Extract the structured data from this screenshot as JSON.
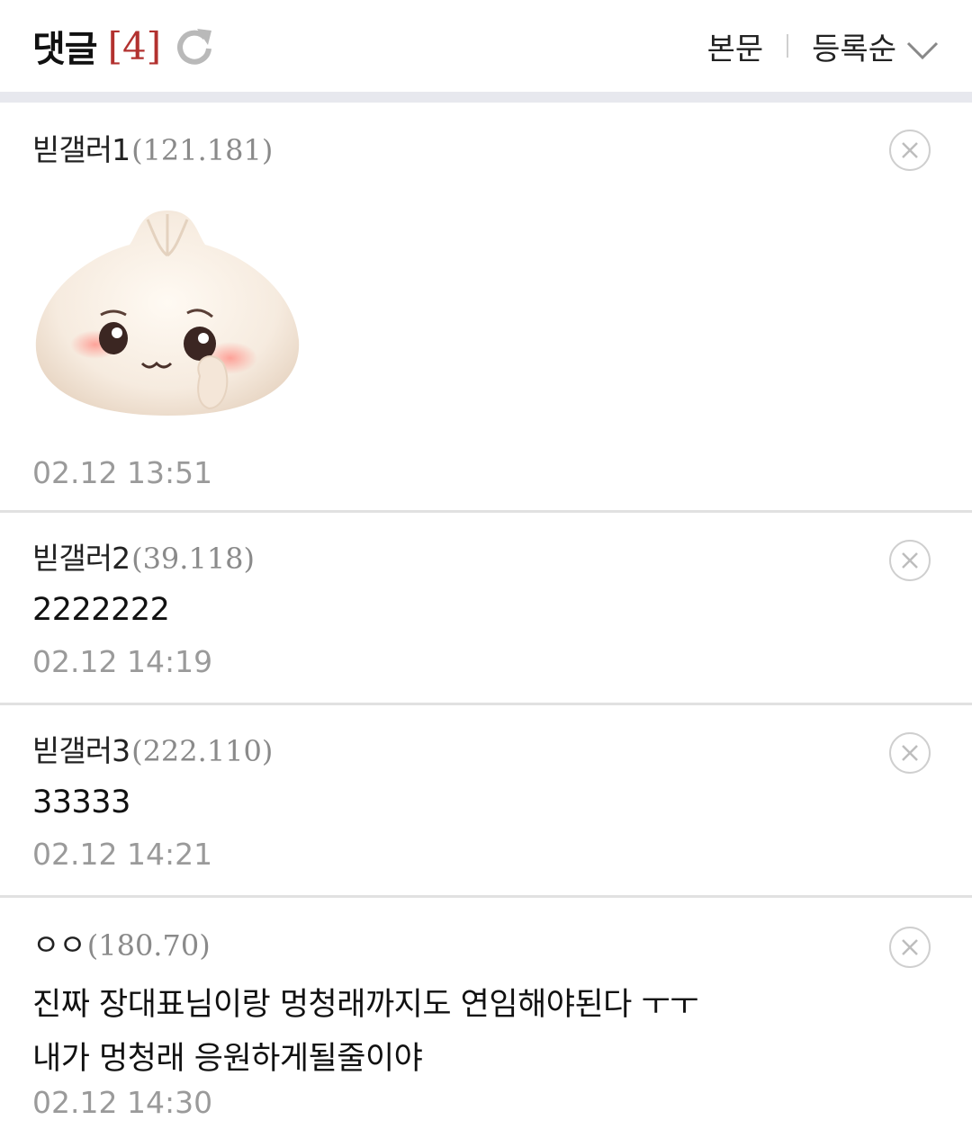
{
  "header": {
    "title": "댓글",
    "count": "[4]",
    "tab_body": "본문",
    "sort_label": "등록순"
  },
  "comments": [
    {
      "nick": "빋갤러1",
      "ip": "(121.181)",
      "text": "",
      "sticker": "crying-dumpling-sticker",
      "date": "02.12 13:51"
    },
    {
      "nick": "빋갤러2",
      "ip": "(39.118)",
      "text": "2222222",
      "date": "02.12 14:19"
    },
    {
      "nick": "빋갤러3",
      "ip": "(222.110)",
      "text": "33333",
      "date": "02.12 14:21"
    },
    {
      "nick": "ㅇㅇ",
      "ip": "(180.70)",
      "text_lines": [
        "진짜 장대표님이랑 멍청래까지도 연임해야된다 ㅜㅜ",
        "내가 멍청래 응원하게될줄이야"
      ],
      "date": "02.12 14:30"
    }
  ],
  "colors": {
    "count": "#b2312f",
    "band": "#e7e8ee",
    "meta": "#9a9a9a"
  }
}
